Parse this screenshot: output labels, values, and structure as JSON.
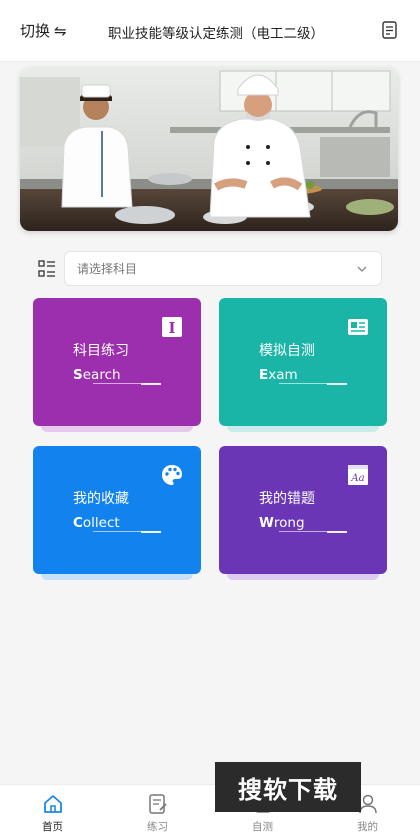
{
  "header": {
    "switch_label": "切换",
    "switch_icon": "⇋",
    "title": "职业技能等级认定练测（电工二级）",
    "note_icon": "note-icon"
  },
  "banner": {
    "icon": "kitchen-chefs-photo"
  },
  "subject_select": {
    "placeholder": "请选择科目"
  },
  "cards": [
    {
      "title": "科目练习",
      "sub_first": "S",
      "sub_rest": "earch",
      "color": "#9b2fae",
      "shadow": "#e7c9ee",
      "icon": "text-cursor-icon"
    },
    {
      "title": "模拟自测",
      "sub_first": "E",
      "sub_rest": "xam",
      "color": "#1bb5a8",
      "shadow": "#c8ece9",
      "icon": "id-card-icon"
    },
    {
      "title": "我的收藏",
      "sub_first": "C",
      "sub_rest": "ollect",
      "color": "#1282ef",
      "shadow": "#c6e0fb",
      "icon": "palette-icon"
    },
    {
      "title": "我的错题",
      "sub_first": "W",
      "sub_rest": "rong",
      "color": "#6b36b5",
      "shadow": "#dccdf0",
      "icon": "font-aa-icon"
    }
  ],
  "tabs": [
    {
      "label": "首页",
      "icon": "home-icon",
      "active": true
    },
    {
      "label": "练习",
      "icon": "edit-doc-icon",
      "active": false
    },
    {
      "label": "自测",
      "icon": "test-icon",
      "active": false
    },
    {
      "label": "我的",
      "icon": "user-icon",
      "active": false
    }
  ],
  "watermark": "搜软下载"
}
